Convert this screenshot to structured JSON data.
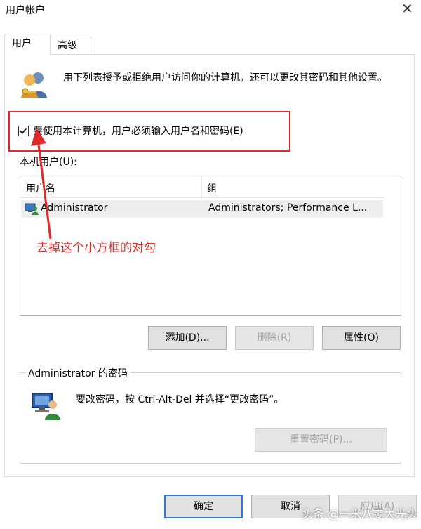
{
  "window": {
    "title": "用户帐户",
    "close_glyph": "✕"
  },
  "tabs": [
    {
      "label": "用户"
    },
    {
      "label": "高级"
    }
  ],
  "description": "用下列表授予或拒绝用户访问你的计算机，还可以更改其密码和其他设置。",
  "checkbox": {
    "label": "要使用本计算机，用户必须输入用户名和密码(E)",
    "checked": true
  },
  "users_list": {
    "label": "本机用户(U):",
    "columns": [
      "用户名",
      "组"
    ],
    "rows": [
      {
        "user": "Administrator",
        "group": "Administrators; Performance L..."
      }
    ]
  },
  "annotation": "去掉这个小方框的对勾",
  "buttons": {
    "add": "添加(D)...",
    "remove": "删除(R)",
    "properties": "属性(O)",
    "reset_password": "重置密码(P)...",
    "ok": "确定",
    "cancel": "取消",
    "apply": "应用(A)"
  },
  "password_group": {
    "title": "Administrator 的密码",
    "text": "要改密码，按 Ctrl-Alt-Del 并选择“更改密码”。"
  },
  "watermark": "头条 @一米八零大光头",
  "colors": {
    "highlight_red": "#e02a2a",
    "primary_border": "#2a7ad4",
    "selection_row": "#eeeeee"
  },
  "icons": {
    "users": "users-key-icon",
    "user_row": "user-account-icon",
    "computer": "computer-user-icon",
    "close": "close-icon"
  }
}
